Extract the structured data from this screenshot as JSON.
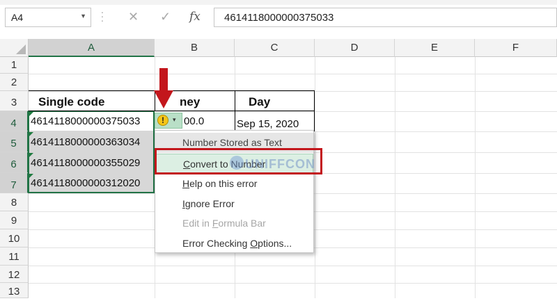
{
  "formula_bar": {
    "name_box": "A4",
    "cancel_glyph": "✕",
    "enter_glyph": "✓",
    "fx_label": "fx",
    "formula_value": "4614118000000375033"
  },
  "columns": [
    "A",
    "B",
    "C",
    "D",
    "E",
    "F"
  ],
  "rows": [
    "1",
    "2",
    "3",
    "4",
    "5",
    "6",
    "7",
    "8",
    "9",
    "10",
    "11",
    "12",
    "13"
  ],
  "cells": {
    "A3": "Single code",
    "B3": "ney",
    "C3": "Day",
    "A4": "4614118000000375033",
    "B4": "00.0",
    "C4": "Sep 15, 2020",
    "A5": "4614118000000363034",
    "A6": "4614118000000355029",
    "A7": "4614118000000312020"
  },
  "error_button": {
    "icon": "warning-icon",
    "glyph": "!",
    "dropdown": "▾"
  },
  "context_menu": {
    "header": "Number Stored as Text",
    "items": [
      {
        "pre": "",
        "ul": "C",
        "post": "onvert to Number"
      },
      {
        "pre": "",
        "ul": "H",
        "post": "elp on this error"
      },
      {
        "pre": "",
        "ul": "I",
        "post": "gnore Error"
      },
      {
        "pre": "Edit in ",
        "ul": "F",
        "post": "ormula Bar"
      },
      {
        "pre": "Error Checking ",
        "ul": "O",
        "post": "ptions..."
      }
    ]
  },
  "watermark": "UNIFFCON",
  "colors": {
    "accent": "#217346",
    "annotation": "#c3161c",
    "error_icon": "#f5c518"
  }
}
